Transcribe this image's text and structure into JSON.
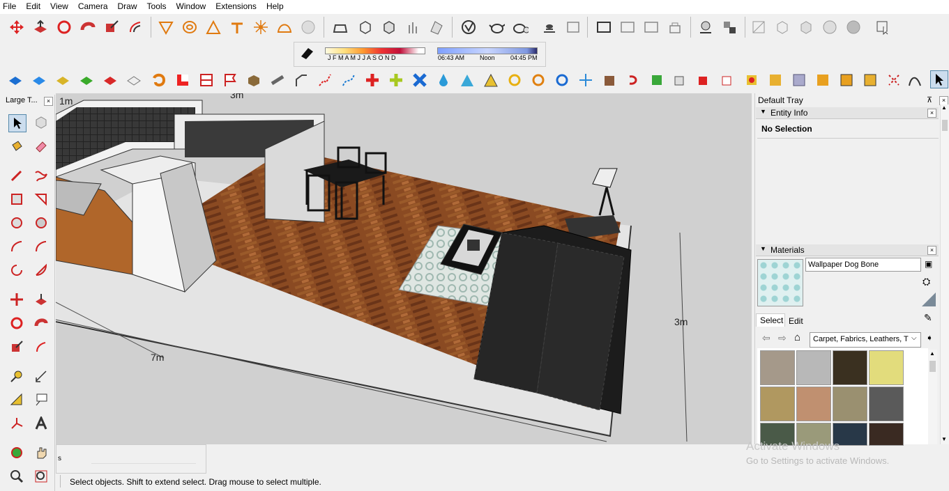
{
  "menu": [
    "File",
    "Edit",
    "View",
    "Camera",
    "Draw",
    "Tools",
    "Window",
    "Extensions",
    "Help"
  ],
  "shadow": {
    "months": "J F M A M J J A S O N D",
    "time_start": "06:43 AM",
    "time_mid": "Noon",
    "time_end": "04:45 PM"
  },
  "left_palette": {
    "title": "Large T..."
  },
  "viewport": {
    "dims": {
      "d1": "1m",
      "d2": "3m",
      "d3": "7m",
      "d4": "3m"
    }
  },
  "measurement": {
    "label": "s"
  },
  "status": {
    "text": "Select objects. Shift to extend select. Drag mouse to select multiple."
  },
  "tray": {
    "title": "Default Tray",
    "entity_info": {
      "heading": "Entity Info",
      "value": "No Selection"
    },
    "materials": {
      "heading": "Materials",
      "current_name": "Wallpaper Dog Bone",
      "tab_select": "Select",
      "tab_edit": "Edit",
      "collection": "Carpet, Fabrics, Leathers, T",
      "swatch_colors": [
        "#a5998a",
        "#b8b8b8",
        "#3a3020",
        "#e2dc7c",
        "#b09860",
        "#c09070",
        "#9a9070",
        "#5a5a5a",
        "#4a5a48",
        "#9a9a7a",
        "#283848",
        "#3a2a22"
      ]
    }
  },
  "watermark": {
    "line1": "Activate Windows",
    "line2": "Go to Settings to activate Windows."
  },
  "colors": {
    "floor": "#8a4a22",
    "carpet": "#cfd8d4",
    "furniture_dark": "#252525",
    "wall": "#e0e0e0"
  }
}
